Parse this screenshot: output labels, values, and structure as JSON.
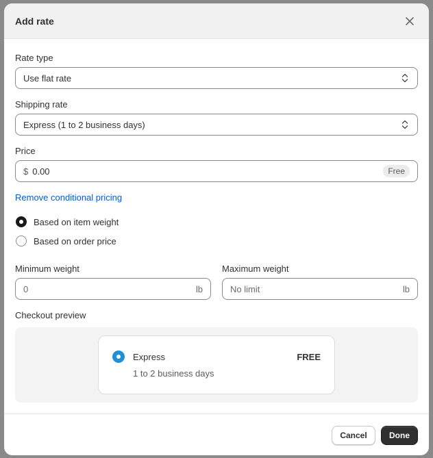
{
  "modal": {
    "title": "Add rate",
    "close_icon": "close-icon"
  },
  "rate_type": {
    "label": "Rate type",
    "value": "Use flat rate",
    "icon": "select-arrows-icon"
  },
  "shipping_rate": {
    "label": "Shipping rate",
    "value": "Express (1 to 2 business days)",
    "icon": "select-arrows-icon"
  },
  "price": {
    "label": "Price",
    "currency_prefix": "$",
    "value": "0.00",
    "badge": "Free"
  },
  "conditional_link": "Remove conditional pricing",
  "conditions": [
    {
      "label": "Based on item weight",
      "checked": true
    },
    {
      "label": "Based on order price",
      "checked": false
    }
  ],
  "minimum_weight": {
    "label": "Minimum weight",
    "placeholder": "0",
    "unit": "lb"
  },
  "maximum_weight": {
    "label": "Maximum weight",
    "placeholder": "No limit",
    "unit": "lb"
  },
  "checkout_preview": {
    "label": "Checkout preview",
    "option_name": "Express",
    "option_price": "FREE",
    "option_subtitle": "1 to 2 business days"
  },
  "footer": {
    "cancel_label": "Cancel",
    "done_label": "Done"
  },
  "colors": {
    "link": "#005bd3",
    "primary_button": "#303030",
    "preview_radio": "#1f8fd6"
  }
}
